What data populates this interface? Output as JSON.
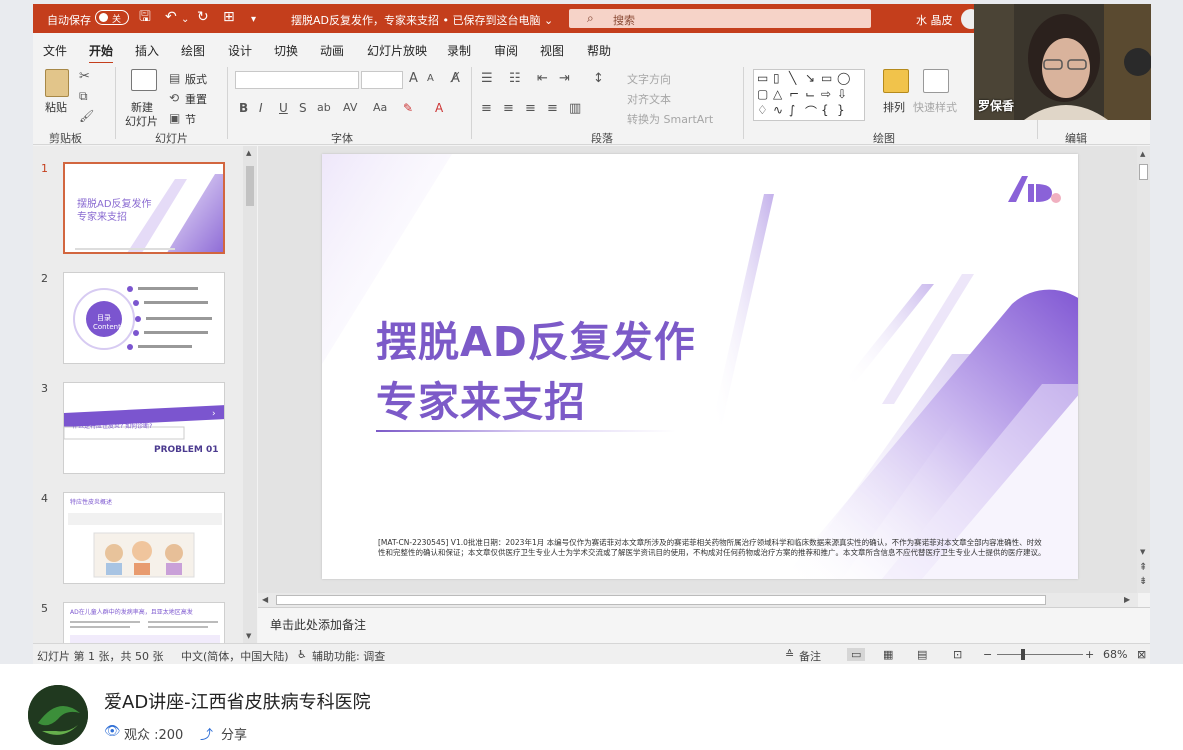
{
  "titlebar": {
    "autosave_label": "自动保存",
    "autosave_state": "关",
    "doc_title": "摆脱AD反复发作，专家来支招 • 已保存到这台电脑 ⌄",
    "search_placeholder": "搜索",
    "user_name": "水 晶皮"
  },
  "tabs": [
    "文件",
    "开始",
    "插入",
    "绘图",
    "设计",
    "切换",
    "动画",
    "幻灯片放映",
    "录制",
    "审阅",
    "视图",
    "帮助"
  ],
  "active_tab": "开始",
  "ribbon": {
    "clipboard": {
      "paste": "粘贴",
      "label": "剪贴板"
    },
    "slides": {
      "new_slide": "新建",
      "new_slide2": "幻灯片",
      "layout": "版式",
      "reset": "重置",
      "section": "节",
      "label": "幻灯片"
    },
    "font": {
      "label": "字体",
      "bold": "B",
      "italic": "I",
      "underline": "U",
      "strike": "S",
      "shadow": "ab",
      "spacing": "AV",
      "case": "Aa",
      "grow": "A",
      "shrink": "A"
    },
    "paragraph": {
      "label": "段落",
      "text_direction": "文字方向",
      "align_text": "对齐文本",
      "smartart": "转换为 SmartArt"
    },
    "drawing": {
      "label": "绘图",
      "arrange": "排列",
      "quick_styles": "快速样式"
    },
    "editing": {
      "label": "编辑"
    }
  },
  "thumbnails": [
    {
      "num": "1",
      "title": "摆脱AD反复发作\n专家来支招"
    },
    {
      "num": "2",
      "title": "目录 Contents"
    },
    {
      "num": "3",
      "title": "什么是特应性皮炎? 如何诊断?",
      "sub": "PROBLEM 01"
    },
    {
      "num": "4",
      "title": "特应性皮炎概述"
    },
    {
      "num": "5",
      "title": "AD在儿童人群中的发病率高，且亚太地区高发"
    }
  ],
  "slide": {
    "title_line1": "摆脱AD反复发作",
    "title_line2": "专家来支招",
    "footnote": "[MAT-CN-2230545] V1.0批准日期：2023年1月 本编号仅作为赛诺菲对本文章所涉及的赛诺菲相关药物所属治疗领域科学和临床数据来源真实性的确认，不作为赛诺菲对本文章全部内容准确性、时效性和完整性的确认和保证；本文章仅供医疗卫生专业人士为学术交流或了解医学资讯目的使用，不构成对任何药物或治疗方案的推荐和推广。本文章所含信息不应代替医疗卫生专业人士提供的医疗建议。"
  },
  "notes_placeholder": "单击此处添加备注",
  "status": {
    "slide_count": "幻灯片 第 1 张，共 50 张",
    "language": "中文(简体，中国大陆)",
    "accessibility": "辅助功能: 调查",
    "notes": "备注",
    "zoom": "68%"
  },
  "camera": {
    "name": "罗保香"
  },
  "channel": {
    "title": "爱AD讲座-江西省皮肤病专科医院",
    "viewers": "观众 :200",
    "share": "分享"
  },
  "colors": {
    "accent": "#c43e1c",
    "slide_purple": "#7c5ac8"
  }
}
